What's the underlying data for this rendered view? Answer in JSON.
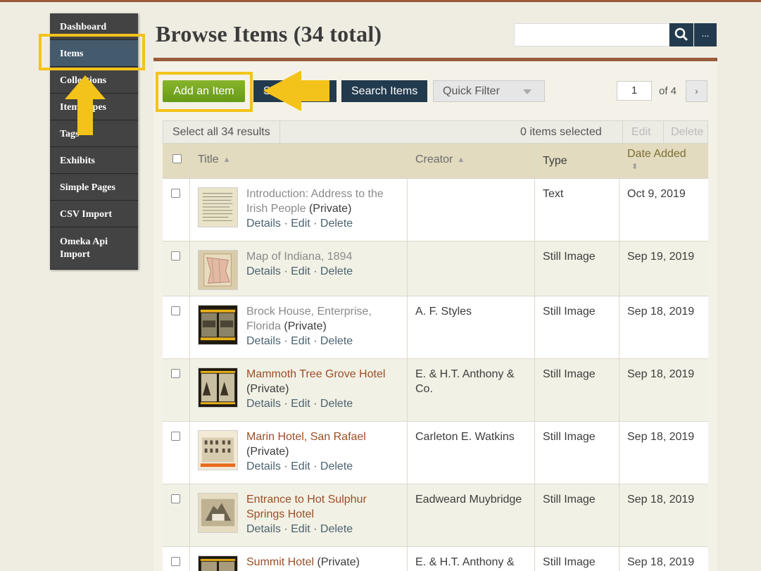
{
  "nav": {
    "items": [
      {
        "label": "Dashboard"
      },
      {
        "label": "Items"
      },
      {
        "label": "Collections"
      },
      {
        "label": "Item Types"
      },
      {
        "label": "Tags"
      },
      {
        "label": "Exhibits"
      },
      {
        "label": "Simple Pages"
      },
      {
        "label": "CSV Import"
      },
      {
        "label": "Omeka Api Import"
      }
    ]
  },
  "header": {
    "title": "Browse Items (34 total)",
    "more_label": "..."
  },
  "toolbar": {
    "add_item": "Add an Item",
    "search_advanced": "Search Items",
    "quick_filter": "Quick Filter",
    "page_number": "1",
    "page_of": "of 4",
    "next": "›",
    "partial_button": "Sh"
  },
  "table": {
    "select_all": "Select all 34 results",
    "selected_count": "0 items selected",
    "edit": "Edit",
    "delete": "Delete",
    "headers": {
      "title": "Title",
      "creator": "Creator",
      "type": "Type",
      "date_added": "Date Added"
    },
    "action_labels": {
      "details": "Details",
      "edit": "Edit",
      "delete": "Delete"
    },
    "rows": [
      {
        "title": "Introduction: Address to the Irish People",
        "private": "(Private)",
        "creator": "",
        "type": "Text",
        "date": "Oct 9, 2019"
      },
      {
        "title": "Map of Indiana, 1894",
        "private": "",
        "creator": "",
        "type": "Still Image",
        "date": "Sep 19, 2019"
      },
      {
        "title": "Brock House, Enterprise, Florida",
        "private": "(Private)",
        "creator": "A. F. Styles",
        "type": "Still Image",
        "date": "Sep 18, 2019"
      },
      {
        "title": "Mammoth Tree Grove Hotel",
        "private": "(Private)",
        "creator": "E. & H.T. Anthony & Co.",
        "type": "Still Image",
        "date": "Sep 18, 2019"
      },
      {
        "title": "Marin Hotel, San Rafael",
        "private": "(Private)",
        "creator": "Carleton E. Watkins",
        "type": "Still Image",
        "date": "Sep 18, 2019"
      },
      {
        "title": "Entrance to Hot Sulphur Springs Hotel",
        "private": "",
        "creator": "Eadweard Muybridge",
        "type": "Still Image",
        "date": "Sep 18, 2019"
      },
      {
        "title": "Summit Hotel",
        "private": "(Private)",
        "creator": "E. & H.T. Anthony &",
        "type": "Still Image",
        "date": "Sep 18, 2019"
      }
    ]
  },
  "colors": {
    "accent_brown": "#9a5a3c",
    "highlight_yellow": "#f3c31b",
    "nav_active": "#445a6d",
    "button_green": "#76a622",
    "button_navy": "#223a4d"
  }
}
